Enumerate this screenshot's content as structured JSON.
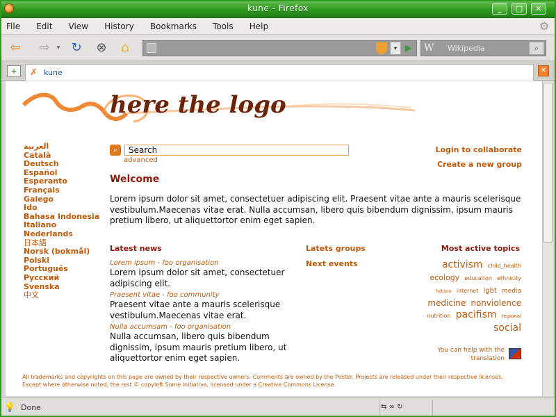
{
  "window": {
    "title": "kune - Firefox",
    "colors": {
      "titlebar": "#2f9a1f",
      "accent": "#c05a0a",
      "heading": "#8a1a0a"
    }
  },
  "menu": {
    "items": [
      "File",
      "Edit",
      "View",
      "History",
      "Bookmarks",
      "Tools",
      "Help"
    ]
  },
  "search_engine": {
    "name": "Wikipedia"
  },
  "tab": {
    "label": "kune"
  },
  "page": {
    "logo_text": "here the logo",
    "languages": [
      {
        "label": "العربية",
        "bold": true
      },
      {
        "label": "Català",
        "bold": true
      },
      {
        "label": "Deutsch",
        "bold": true
      },
      {
        "label": "Español",
        "bold": true
      },
      {
        "label": "Esperanto",
        "bold": true
      },
      {
        "label": "Français",
        "bold": true
      },
      {
        "label": "Galego",
        "bold": true
      },
      {
        "label": "Ido",
        "bold": true
      },
      {
        "label": "Bahasa Indonesia",
        "bold": true
      },
      {
        "label": "Italiano",
        "bold": true
      },
      {
        "label": "Nederlands",
        "bold": true
      },
      {
        "label": "日本語",
        "bold": false
      },
      {
        "label": "Norsk (bokmål)",
        "bold": true
      },
      {
        "label": "Polski",
        "bold": true
      },
      {
        "label": "Português",
        "bold": true
      },
      {
        "label": "Русский",
        "bold": true
      },
      {
        "label": "Svenska",
        "bold": true
      },
      {
        "label": "中文",
        "bold": false
      }
    ],
    "search": {
      "value": "Search",
      "advanced_label": "advanced"
    },
    "login_label": "Login to collaborate",
    "create_group_label": "Create a new group",
    "welcome": {
      "title": "Welcome",
      "body": "Lorem ipsum dolor sit amet, consectetuer adipiscing elit. Praesent vitae ante a mauris scelerisque vestibulum.Maecenas vitae erat. Nulla accumsan, libero quis bibendum dignissim, ipsum mauris pretium libero, ut aliquettortor enim eget sapien."
    },
    "latest_news": {
      "heading": "Latest news",
      "items": [
        {
          "meta": "Lorem ipsum - foo organisation",
          "text": "Lorem ipsum dolor sit amet, consectetuer adipiscing elit."
        },
        {
          "meta": "Praesent vitae - foo community",
          "text": "Praesent vitae ante a mauris scelerisque vestibulum.Maecenas vitae erat."
        },
        {
          "meta": "Nulla accumsam - foo organisation",
          "text": "Nulla accumsan, libero quis bibendum dignissim, ipsum mauris pretium libero, ut aliquettortor enim eget sapien."
        }
      ]
    },
    "latest_groups_label": "Latets groups",
    "next_events_label": "Next events",
    "topics": {
      "heading": "Most active topics",
      "tags": [
        {
          "label": "activism",
          "size": 14
        },
        {
          "label": "child_health",
          "size": 8
        },
        {
          "label": "ecology",
          "size": 11
        },
        {
          "label": "education",
          "size": 8
        },
        {
          "label": "ethnicity",
          "size": 8
        },
        {
          "label": "folklore",
          "size": 6
        },
        {
          "label": "internet",
          "size": 8
        },
        {
          "label": "lgbt",
          "size": 10
        },
        {
          "label": "media",
          "size": 9
        },
        {
          "label": "medicine",
          "size": 12
        },
        {
          "label": "nonviolence",
          "size": 12
        },
        {
          "label": "nutrition",
          "size": 8
        },
        {
          "label": "pacifism",
          "size": 14
        },
        {
          "label": "regional",
          "size": 7
        },
        {
          "label": "social",
          "size": 14
        }
      ]
    },
    "help_translation": "You can help with the translation",
    "footer_lines": [
      "All trademarks and copyrights on this page are owned by their respective owners. Comments are owned by the Poster. Projects are released under their respective licenses.",
      "Except where otherwise noted, the rest © copyleft Some Initiative, licensed under a Creative Commons License."
    ]
  },
  "status": {
    "text": "Done"
  }
}
